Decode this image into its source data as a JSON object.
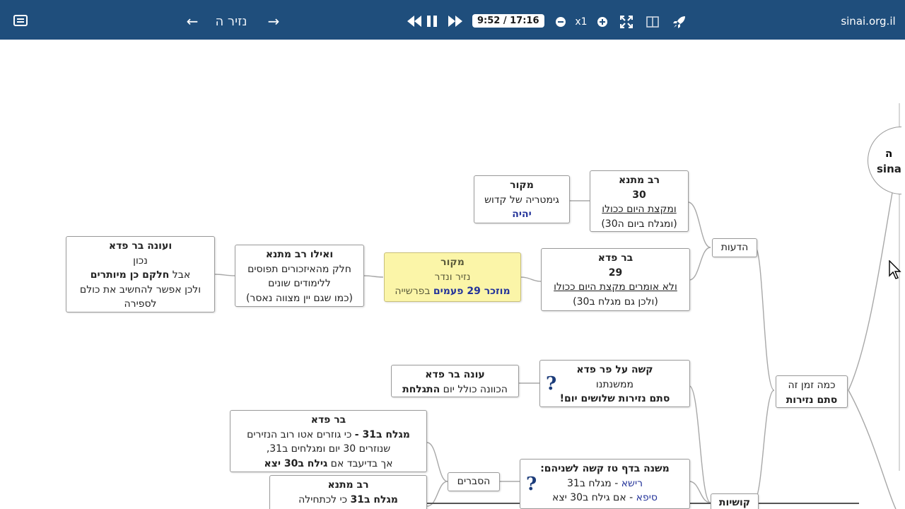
{
  "topbar": {
    "menu_icon": "menu-icon",
    "prev_icon": "arrow-left-icon",
    "title": "נזיר ה",
    "next_icon": "arrow-right-icon",
    "rewind_icon": "rewind-icon",
    "pause_icon": "pause-icon",
    "forward_icon": "fast-forward-icon",
    "time": "9:52 / 17:16",
    "zoom_out_icon": "minus-circle-icon",
    "speed": "x1",
    "zoom_in_icon": "plus-circle-icon",
    "fullscreen_icon": "expand-icon",
    "layout_icon": "split-view-icon",
    "rocket_icon": "rocket-icon",
    "site": "sinai.org.il",
    "bar_color": "#1f4e7c"
  },
  "root": {
    "line1": "ה",
    "line2": "sina"
  },
  "nodes": {
    "rav_matna": {
      "l1": "רב מתנא",
      "l2": "30",
      "l3": "ומקצת היום ככולו",
      "l4": "(ומגלח ביום ה30)"
    },
    "makor1": {
      "l1": "מקור",
      "l2": "גימטריה של קדוש",
      "l3": "יהיה"
    },
    "bar_pada": {
      "l1": "בר פדא",
      "l2": "29",
      "l3": "ולא אומרים מקצת היום ככולו",
      "l4": "(ולכן גם מגלח ב30)"
    },
    "makor2": {
      "l1": "מקור",
      "l2": "נזיר ונדר",
      "l3a": "מוזכר 29 פעמים",
      "l3b": " בפרשייה"
    },
    "veilu": {
      "l1": "ואילו רב מתנא",
      "l2": "חלק מהאיזכורים תפוסים",
      "l3": "ללימודים שונים",
      "l4": "(כמו שגם יין מצווה נאסר)"
    },
    "veone": {
      "l1": "ועונה בר פדא",
      "l2": "נכון",
      "l3a": "אבל ",
      "l3b": "חלקם כן מיותרים",
      "l4": "ולכן אפשר להחשיב את כולם",
      "l5": "לספירה"
    },
    "hadeot": {
      "l1": "הדעות"
    },
    "kama": {
      "l1": "כמה זמן זה",
      "l2": "סתם נזירות"
    },
    "kashe": {
      "l1": "קשה על פר פדא",
      "l2": "ממשנתנו",
      "l3": "סתם נזירות שלושים יום!"
    },
    "one2": {
      "l1": "עונה בר פדא",
      "l2a": "הכוונה כולל יום ",
      "l2b": "התגלחת"
    },
    "bar_pada2": {
      "l1": "בר פדא",
      "l2a": "מגלח ב31 -",
      "l2b": " כי גוזרים אטו רוב הנזירים",
      "l3": "שנוזרים 30 יום ומגלחים ב31,",
      "l4a": "אך בדיעבד אם ",
      "l4b": "גילח ב30 יצא"
    },
    "hesberim": {
      "l1": "הסברים"
    },
    "mishna": {
      "l1": "משנה בדף טז קשה לשניהם:",
      "l2a": "רישא",
      "l2b": " - מגלח ב31",
      "l3a": "סיפא",
      "l3b": " - אם גילח ב30 יצא"
    },
    "rav_matna2": {
      "l1": "רב מתנא",
      "l2a": "מגלח ב31",
      "l2b": " כי לכתחילה"
    },
    "kushiot": {
      "l1": "קושיות"
    }
  },
  "colors": {
    "highlight_yellow": "#fbf5a8",
    "emphasis_blue": "#24349a",
    "question_mark": "#1c3c7a"
  }
}
